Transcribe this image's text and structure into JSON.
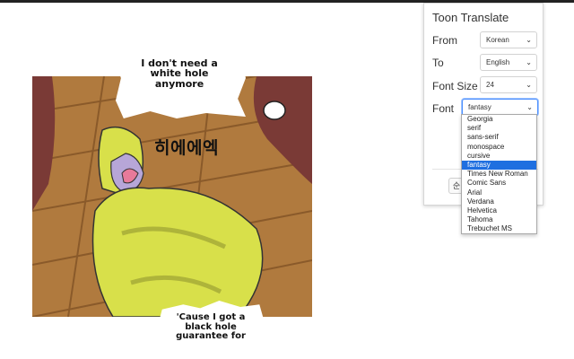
{
  "comic": {
    "bubble_top": "I don't need a white hole anymore",
    "sfx": "히에에엑",
    "bubble_bottom": "'Cause I got a black hole guarantee for",
    "colors": {
      "floor": "#b07a3e",
      "floor_dark": "#8a5a2a",
      "costume": "#d8e04a",
      "costume_shadow": "#aeb43a",
      "face": "#b7a6d8",
      "mouth": "#e87a9a",
      "wall": "#7a3a36"
    }
  },
  "popup": {
    "title": "Toon Translate",
    "from_label": "From",
    "from_value": "Korean",
    "to_label": "To",
    "to_value": "English",
    "font_size_label": "Font Size",
    "font_size_value": "24",
    "font_label": "Font",
    "font_value": "fantasy",
    "translate_button_label": "순",
    "font_options": [
      "Georgia",
      "serif",
      "sans-serif",
      "monospace",
      "cursive",
      "fantasy",
      "Times New Roman",
      "Comic Sans",
      "Arial",
      "Verdana",
      "Helvetica",
      "Tahoma",
      "Trebuchet MS"
    ],
    "selected_font_index": 5,
    "accent_color": "#1e6fe0"
  },
  "icons": {
    "select_arrow": "chevron-down-icon"
  }
}
